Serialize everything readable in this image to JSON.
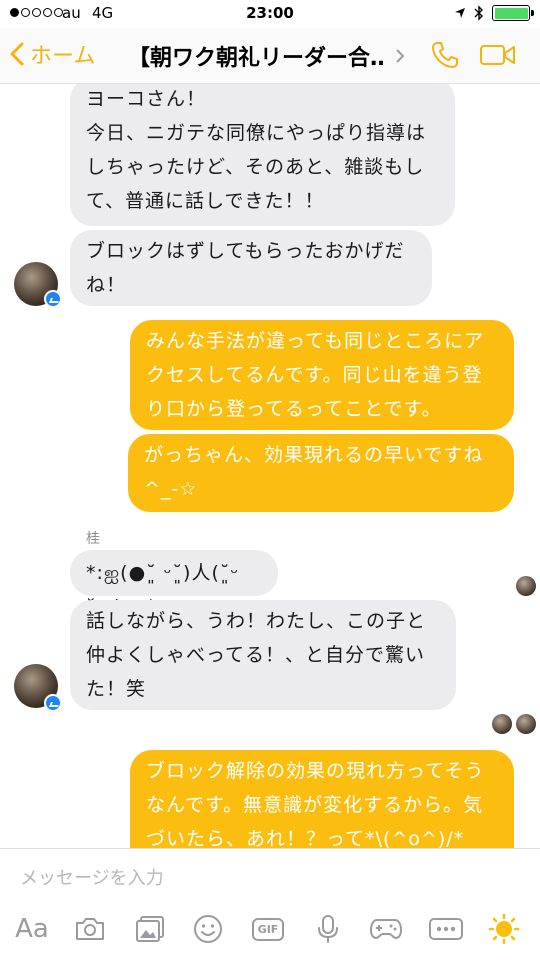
{
  "status_bar": {
    "signal_dots": [
      true,
      false,
      false,
      false,
      false
    ],
    "carrier": "au",
    "network": "4G",
    "time": "23:00"
  },
  "nav": {
    "back_label": "ホーム",
    "title": "【朝ワク朝礼リーダー合…",
    "accent_color": "#f3b412"
  },
  "messages": [
    {
      "direction": "in",
      "text": "ヨーコさん！\n今日、ニガテな同僚にやっぱり指導は\nしちゃったけど、そのあと、雑談もし\nて、普通に話しできた！！"
    },
    {
      "direction": "in",
      "text": "ブロックはずしてもらったおかげだ\nね！"
    },
    {
      "direction": "out",
      "text": "みんな手法が違っても同じところにア\nクセスしてるんです。同じ山を違う登\nり口から登ってるってことです。"
    },
    {
      "direction": "out",
      "text": "がっちゃん、効果現れるの早いですね\n^_-☆"
    },
    {
      "direction": "in",
      "sender": "桂",
      "text": "*:ஐ(●˘͈ ᵕ˘͈)人(˘͈ᵕ ˘͈●)ஐ:*"
    },
    {
      "direction": "in",
      "text": "話しながら、うわ！わたし、この子と\n仲よくしゃべってる！、と自分で驚い\nた！笑"
    },
    {
      "direction": "out",
      "text": "ブロック解除の効果の現れ方ってそう\nなんです。無意識が変化するから。気\nづいたら、あれ！？って*\\(^o^)/*"
    }
  ],
  "composer": {
    "placeholder": "メッセージを入力",
    "aa_label": "Aa",
    "gif_label": "GIF",
    "accent_color": "#fbbd0f"
  }
}
